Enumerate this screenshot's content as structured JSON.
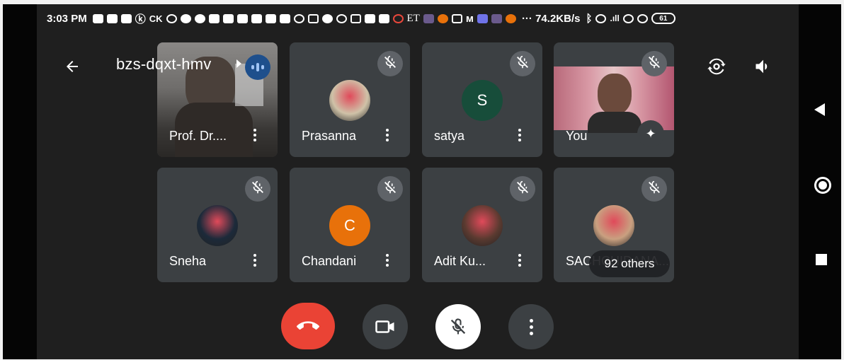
{
  "statusbar": {
    "time": "3:03 PM",
    "text_icons": [
      "ⓚ",
      "CK",
      "ET"
    ],
    "speed": "··· 74.2KB/s",
    "battery": "61",
    "icons": [
      "message-icon",
      "message-icon",
      "message-icon",
      "k-icon",
      "ck-icon",
      "graduation-cap-icon",
      "app-icon",
      "app-icon",
      "youtube-icon",
      "youtube-icon",
      "youtube-icon",
      "youtube-icon",
      "youtube-icon",
      "youtube-icon",
      "pinterest-icon",
      "filter-icon",
      "app-icon",
      "bell-icon",
      "video-icon",
      "app-icon",
      "app-icon",
      "app-icon",
      "et-icon",
      "image-icon",
      "app-icon",
      "instagram-icon",
      "m-icon",
      "app-icon",
      "image-icon",
      "app-icon",
      "bluetooth-icon",
      "alarm-icon",
      "signal-icon",
      "wifi-icon",
      "wifi-icon",
      "battery-icon"
    ]
  },
  "header": {
    "meeting_code": "bzs-dqxt-hmv",
    "back_icon": "arrow-left-icon",
    "switch_camera_icon": "switch-camera-icon",
    "speaker_icon": "volume-icon"
  },
  "participants": [
    {
      "name": "Prof. Dr....",
      "type": "video",
      "muted": false
    },
    {
      "name": "Prasanna",
      "type": "avatar-image",
      "muted": true
    },
    {
      "name": "satya",
      "type": "letter",
      "letter": "S",
      "color": "#174d3a",
      "muted": true
    },
    {
      "name": "You",
      "type": "video",
      "muted": true
    },
    {
      "name": "Sneha",
      "type": "avatar-image",
      "muted": true
    },
    {
      "name": "Chandani",
      "type": "letter",
      "letter": "C",
      "color": "#e8710a",
      "muted": true
    },
    {
      "name": "Adit Ku...",
      "type": "avatar-image",
      "muted": true
    },
    {
      "name": "SACHCHIDANA...",
      "type": "avatar-image",
      "muted": true
    }
  ],
  "others_chip": "92 others",
  "controls": {
    "end_call_color": "#ea4335",
    "camera_icon": "video-camera-icon",
    "mic_icon": "mic-off-icon",
    "more_icon": "more-vert-icon"
  },
  "navbar": [
    "back-triangle-icon",
    "home-circle-icon",
    "recents-square-icon"
  ],
  "colors": {
    "tile": "#3c4043",
    "background": "#1f1f1f",
    "mute_badge": "#5f6368"
  }
}
